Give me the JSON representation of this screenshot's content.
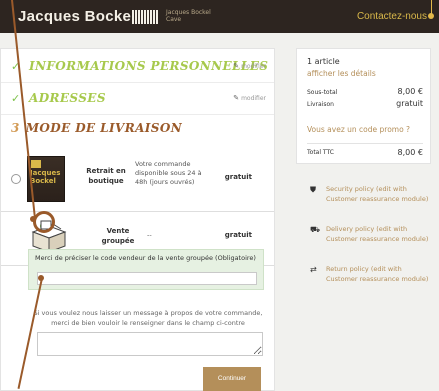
{
  "header": {
    "brand": "Jacques Bockel",
    "brand_sub": "Jacques Bockel Cave",
    "contact_link": "Contactez-nous"
  },
  "steps": {
    "info": {
      "title": "INFORMATIONS PERSONNELLES",
      "edit": "modifier"
    },
    "address": {
      "title": "ADRESSES",
      "edit": "modifier"
    },
    "shipping": {
      "number": "3",
      "title": "MODE DE LIVRAISON"
    }
  },
  "shipping_options": [
    {
      "name_line1": "Retrait en",
      "name_line2": "boutique",
      "desc_line1": "Votre commande",
      "desc_line2": "disponible sous 24 à",
      "desc_line3": "48h (jours ouvrés)",
      "price": "gratuit",
      "selected": false,
      "thumb_text1": "Jacques",
      "thumb_text2": "Bockel"
    },
    {
      "name_line1": "Vente",
      "name_line2": "groupée",
      "desc": "--",
      "price": "gratuit",
      "selected": true
    }
  ],
  "vendor_code": {
    "label": "Merci de préciser le code vendeur de la vente groupée (Obligatoire)"
  },
  "message": {
    "line1": "Si vous voulez nous laisser un message à propos de votre commande,",
    "line2": "merci de bien vouloir le renseigner dans le champ ci-contre"
  },
  "continue_label": "Continuer",
  "summary": {
    "count": "1 article",
    "details_link": "afficher les détails",
    "subtotal_label": "Sous-total",
    "subtotal_value": "8,00 €",
    "shipping_label": "Livraison",
    "shipping_value": "gratuit",
    "promo_link": "Vous avez un code promo ?",
    "total_label": "Total TTC",
    "total_value": "8,00 €"
  },
  "policies": [
    {
      "icon": "shield-icon",
      "line1": "Security policy (edit with",
      "line2": "Customer reassurance module)"
    },
    {
      "icon": "truck-icon",
      "line1": "Delivery policy (edit with",
      "line2": "Customer reassurance module)"
    },
    {
      "icon": "exchange-icon",
      "line1": "Return policy (edit with",
      "line2": "Customer reassurance module)"
    }
  ],
  "colors": {
    "header_bg": "#2d2520",
    "accent_gold": "#b48f5a",
    "step_done_green": "#a7c94c",
    "step_current_brown": "#9a5a2a",
    "selected_radio": "#7ec24a",
    "annotation_brown": "#9a5a2a",
    "annotation_yellow": "#e2b84a"
  }
}
